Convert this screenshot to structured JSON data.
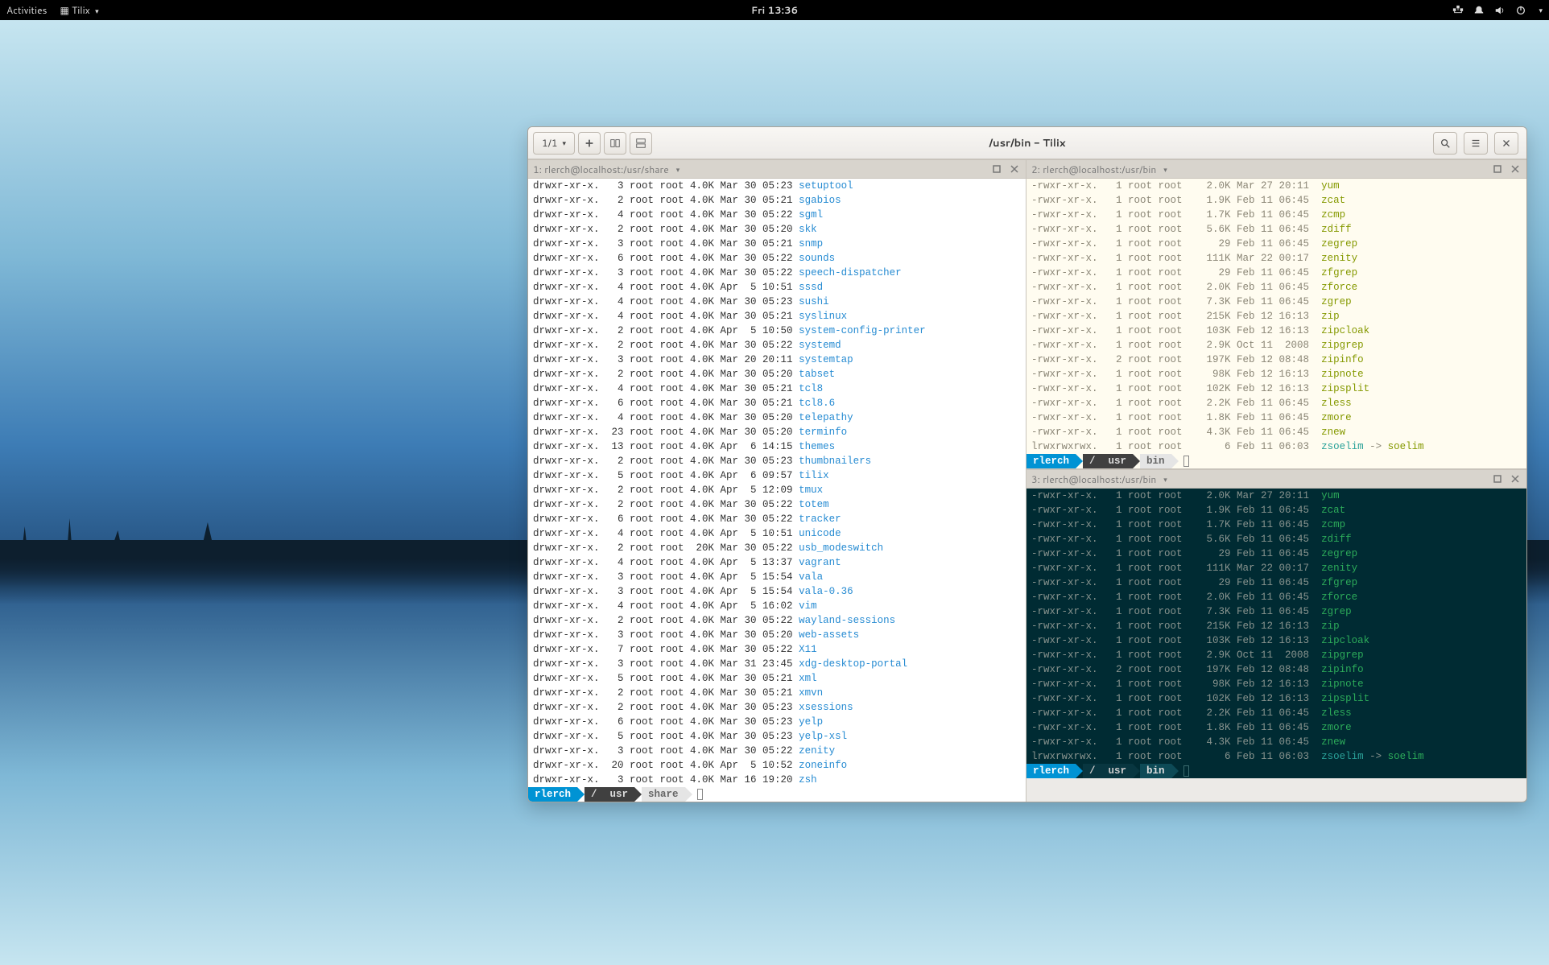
{
  "topbar": {
    "activities": "Activities",
    "app": "Tilix",
    "clock": "Fri 13:36"
  },
  "window": {
    "sessions_label": "1/1",
    "title": "/usr/bin - Tilix"
  },
  "pane1": {
    "header": "1: rlerch@localhost:/usr/share",
    "prompt_user": "rlerch",
    "prompt_path1": "/",
    "prompt_path2": "usr",
    "prompt_path3": "share",
    "rows": [
      {
        "p": "drwxr-xr-x.   3 root root 4.0K Mar 30 05:23 ",
        "n": "setuptool"
      },
      {
        "p": "drwxr-xr-x.   2 root root 4.0K Mar 30 05:21 ",
        "n": "sgabios"
      },
      {
        "p": "drwxr-xr-x.   4 root root 4.0K Mar 30 05:22 ",
        "n": "sgml"
      },
      {
        "p": "drwxr-xr-x.   2 root root 4.0K Mar 30 05:20 ",
        "n": "skk"
      },
      {
        "p": "drwxr-xr-x.   3 root root 4.0K Mar 30 05:21 ",
        "n": "snmp"
      },
      {
        "p": "drwxr-xr-x.   6 root root 4.0K Mar 30 05:22 ",
        "n": "sounds"
      },
      {
        "p": "drwxr-xr-x.   3 root root 4.0K Mar 30 05:22 ",
        "n": "speech-dispatcher"
      },
      {
        "p": "drwxr-xr-x.   4 root root 4.0K Apr  5 10:51 ",
        "n": "sssd"
      },
      {
        "p": "drwxr-xr-x.   4 root root 4.0K Mar 30 05:23 ",
        "n": "sushi"
      },
      {
        "p": "drwxr-xr-x.   4 root root 4.0K Mar 30 05:21 ",
        "n": "syslinux"
      },
      {
        "p": "drwxr-xr-x.   2 root root 4.0K Apr  5 10:50 ",
        "n": "system-config-printer"
      },
      {
        "p": "drwxr-xr-x.   2 root root 4.0K Mar 30 05:22 ",
        "n": "systemd"
      },
      {
        "p": "drwxr-xr-x.   3 root root 4.0K Mar 20 20:11 ",
        "n": "systemtap"
      },
      {
        "p": "drwxr-xr-x.   2 root root 4.0K Mar 30 05:20 ",
        "n": "tabset"
      },
      {
        "p": "drwxr-xr-x.   4 root root 4.0K Mar 30 05:21 ",
        "n": "tcl8"
      },
      {
        "p": "drwxr-xr-x.   6 root root 4.0K Mar 30 05:21 ",
        "n": "tcl8.6"
      },
      {
        "p": "drwxr-xr-x.   4 root root 4.0K Mar 30 05:20 ",
        "n": "telepathy"
      },
      {
        "p": "drwxr-xr-x.  23 root root 4.0K Mar 30 05:20 ",
        "n": "terminfo"
      },
      {
        "p": "drwxr-xr-x.  13 root root 4.0K Apr  6 14:15 ",
        "n": "themes"
      },
      {
        "p": "drwxr-xr-x.   2 root root 4.0K Mar 30 05:23 ",
        "n": "thumbnailers"
      },
      {
        "p": "drwxr-xr-x.   5 root root 4.0K Apr  6 09:57 ",
        "n": "tilix"
      },
      {
        "p": "drwxr-xr-x.   2 root root 4.0K Apr  5 12:09 ",
        "n": "tmux"
      },
      {
        "p": "drwxr-xr-x.   2 root root 4.0K Mar 30 05:22 ",
        "n": "totem"
      },
      {
        "p": "drwxr-xr-x.   6 root root 4.0K Mar 30 05:22 ",
        "n": "tracker"
      },
      {
        "p": "drwxr-xr-x.   4 root root 4.0K Apr  5 10:51 ",
        "n": "unicode"
      },
      {
        "p": "drwxr-xr-x.   2 root root  20K Mar 30 05:22 ",
        "n": "usb_modeswitch"
      },
      {
        "p": "drwxr-xr-x.   4 root root 4.0K Apr  5 13:37 ",
        "n": "vagrant"
      },
      {
        "p": "drwxr-xr-x.   3 root root 4.0K Apr  5 15:54 ",
        "n": "vala"
      },
      {
        "p": "drwxr-xr-x.   3 root root 4.0K Apr  5 15:54 ",
        "n": "vala-0.36"
      },
      {
        "p": "drwxr-xr-x.   4 root root 4.0K Apr  5 16:02 ",
        "n": "vim"
      },
      {
        "p": "drwxr-xr-x.   2 root root 4.0K Mar 30 05:22 ",
        "n": "wayland-sessions"
      },
      {
        "p": "drwxr-xr-x.   3 root root 4.0K Mar 30 05:20 ",
        "n": "web-assets"
      },
      {
        "p": "drwxr-xr-x.   7 root root 4.0K Mar 30 05:22 ",
        "n": "X11"
      },
      {
        "p": "drwxr-xr-x.   3 root root 4.0K Mar 31 23:45 ",
        "n": "xdg-desktop-portal"
      },
      {
        "p": "drwxr-xr-x.   5 root root 4.0K Mar 30 05:21 ",
        "n": "xml"
      },
      {
        "p": "drwxr-xr-x.   2 root root 4.0K Mar 30 05:21 ",
        "n": "xmvn"
      },
      {
        "p": "drwxr-xr-x.   2 root root 4.0K Mar 30 05:23 ",
        "n": "xsessions"
      },
      {
        "p": "drwxr-xr-x.   6 root root 4.0K Mar 30 05:23 ",
        "n": "yelp"
      },
      {
        "p": "drwxr-xr-x.   5 root root 4.0K Mar 30 05:23 ",
        "n": "yelp-xsl"
      },
      {
        "p": "drwxr-xr-x.   3 root root 4.0K Mar 30 05:22 ",
        "n": "zenity"
      },
      {
        "p": "drwxr-xr-x.  20 root root 4.0K Apr  5 10:52 ",
        "n": "zoneinfo"
      },
      {
        "p": "drwxr-xr-x.   3 root root 4.0K Mar 16 19:20 ",
        "n": "zsh"
      }
    ]
  },
  "pane2": {
    "header": "2: rlerch@localhost:/usr/bin",
    "prompt_user": "rlerch",
    "prompt_path1": "/",
    "prompt_path2": "usr",
    "prompt_path3": "bin",
    "rows": [
      {
        "p": "-rwxr-xr-x.   1 root root    2.0K Mar 27 20:11  ",
        "n": "yum"
      },
      {
        "p": "-rwxr-xr-x.   1 root root    1.9K Feb 11 06:45  ",
        "n": "zcat"
      },
      {
        "p": "-rwxr-xr-x.   1 root root    1.7K Feb 11 06:45  ",
        "n": "zcmp"
      },
      {
        "p": "-rwxr-xr-x.   1 root root    5.6K Feb 11 06:45  ",
        "n": "zdiff"
      },
      {
        "p": "-rwxr-xr-x.   1 root root      29 Feb 11 06:45  ",
        "n": "zegrep"
      },
      {
        "p": "-rwxr-xr-x.   1 root root    111K Mar 22 00:17  ",
        "n": "zenity"
      },
      {
        "p": "-rwxr-xr-x.   1 root root      29 Feb 11 06:45  ",
        "n": "zfgrep"
      },
      {
        "p": "-rwxr-xr-x.   1 root root    2.0K Feb 11 06:45  ",
        "n": "zforce"
      },
      {
        "p": "-rwxr-xr-x.   1 root root    7.3K Feb 11 06:45  ",
        "n": "zgrep"
      },
      {
        "p": "-rwxr-xr-x.   1 root root    215K Feb 12 16:13  ",
        "n": "zip"
      },
      {
        "p": "-rwxr-xr-x.   1 root root    103K Feb 12 16:13  ",
        "n": "zipcloak"
      },
      {
        "p": "-rwxr-xr-x.   1 root root    2.9K Oct 11  2008  ",
        "n": "zipgrep"
      },
      {
        "p": "-rwxr-xr-x.   2 root root    197K Feb 12 08:48  ",
        "n": "zipinfo"
      },
      {
        "p": "-rwxr-xr-x.   1 root root     98K Feb 12 16:13  ",
        "n": "zipnote"
      },
      {
        "p": "-rwxr-xr-x.   1 root root    102K Feb 12 16:13  ",
        "n": "zipsplit"
      },
      {
        "p": "-rwxr-xr-x.   1 root root    2.2K Feb 11 06:45  ",
        "n": "zless"
      },
      {
        "p": "-rwxr-xr-x.   1 root root    1.8K Feb 11 06:45  ",
        "n": "zmore"
      },
      {
        "p": "-rwxr-xr-x.   1 root root    4.3K Feb 11 06:45  ",
        "n": "znew"
      },
      {
        "p": "lrwxrwxrwx.   1 root root       6 Feb 11 06:03  ",
        "n": "zsoelim",
        "ln": " -> ",
        "t": "soelim"
      }
    ]
  },
  "pane3": {
    "header": "3: rlerch@localhost:/usr/bin",
    "prompt_user": "rlerch",
    "prompt_path1": "/",
    "prompt_path2": "usr",
    "prompt_path3": "bin"
  }
}
